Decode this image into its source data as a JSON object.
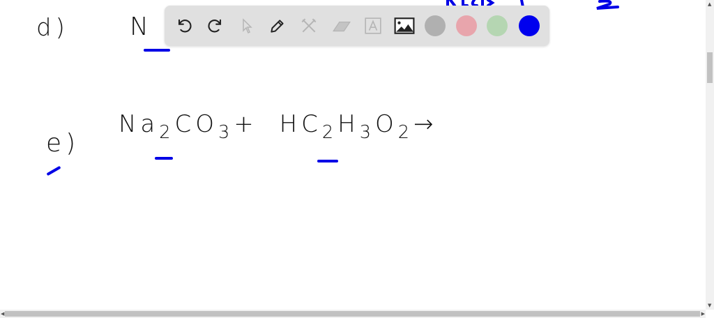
{
  "canvas": {
    "line_d": {
      "label": "d)",
      "formula_start": "N"
    },
    "line_e": {
      "label": "e)",
      "r1": "Na",
      "r1_sub1": "2",
      "r1_mid": "CO",
      "r1_sub2": "3",
      "plus": "+",
      "r2a": "HC",
      "r2_sub1": "2",
      "r2b": "H",
      "r2_sub2": "3",
      "r2c": "O",
      "r2_sub3": "2",
      "arrow": "→"
    }
  },
  "toolbar": {
    "tools": [
      "undo-icon",
      "redo-icon",
      "select-icon",
      "pen-icon",
      "tools-icon",
      "eraser-icon",
      "text-icon",
      "image-icon"
    ],
    "colors": [
      "#b0b0b0",
      "#e8a5ac",
      "#b5d6b2",
      "#0000ee"
    ],
    "selected_color": "#0000ee"
  },
  "colors": {
    "ink": "#111111",
    "annotation": "#0000e6",
    "toolbar_bg": "#e0e0e0"
  }
}
